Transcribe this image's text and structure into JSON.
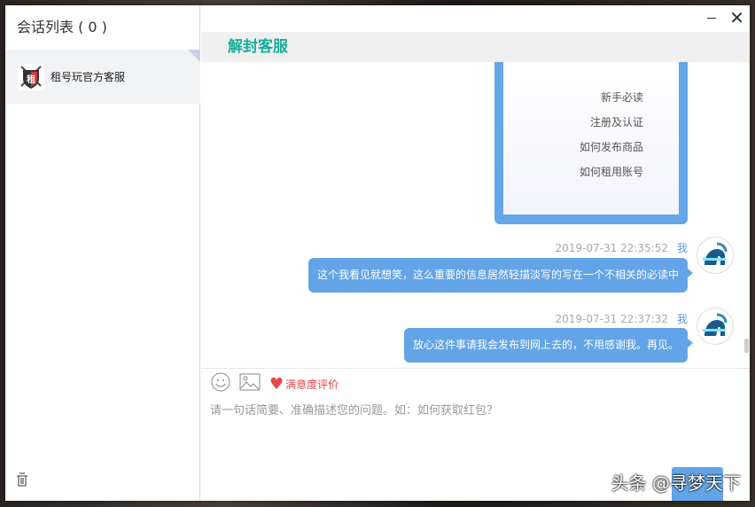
{
  "sidebar": {
    "title": "会话列表 ( 0 )",
    "items": [
      {
        "label": "租号玩官方客服"
      }
    ]
  },
  "header": {
    "title": "解封客服"
  },
  "card": {
    "links": [
      "新手必读",
      "注册及认证",
      "如何发布商品",
      "如何租用账号"
    ]
  },
  "messages": [
    {
      "time": "2019-07-31 22:35:52",
      "sender": "我",
      "text": "这个我看见就想笑，这么重要的信息居然轻描淡写的写在一个不相关的必读中"
    },
    {
      "time": "2019-07-31 22:37:32",
      "sender": "我",
      "text": "放心这件事请我会发布到网上去的，不用感谢我。再见。"
    }
  ],
  "composer": {
    "rating_label": "满意度评价",
    "placeholder": "请一句话简要、准确描述您的问题。如：如何获取红包？"
  },
  "watermark": "头条 @寻梦天下"
}
